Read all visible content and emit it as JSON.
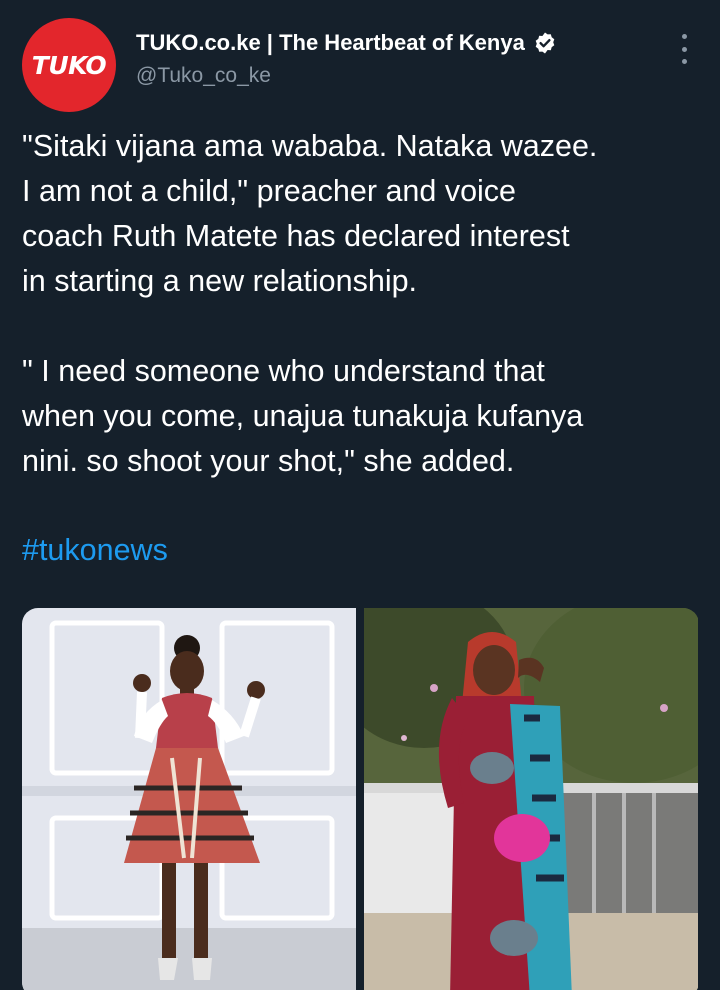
{
  "account": {
    "avatar_text": "TUKO",
    "display_name": "TUKO.co.ke | The Heartbeat of Kenya",
    "handle": "@Tuko_co_ke",
    "verified": true
  },
  "tweet": {
    "paragraph1": [
      "\"Sitaki vijana ama wababa. Nataka wazee.",
      "I am not a child,\" preacher and voice",
      "coach Ruth Matete has declared interest",
      "in starting a new relationship."
    ],
    "paragraph2": [
      "\" I need someone who understand that",
      "when you come, unajua tunakuja kufanya",
      "nini. so shoot your shot,\" she added."
    ],
    "hashtag": "#tukonews"
  },
  "icons": {
    "verified": "verified-badge-icon",
    "more": "more-options-icon"
  },
  "colors": {
    "background": "#15202b",
    "text": "#ffffff",
    "secondary": "#8b98a5",
    "link": "#1d9bf0",
    "brand": "#e3262c"
  }
}
